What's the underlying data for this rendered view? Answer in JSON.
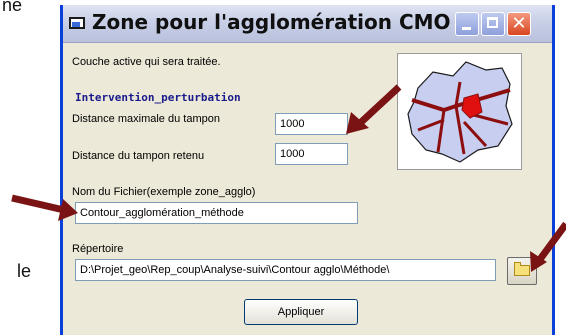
{
  "background": {
    "left_fragment_top": "ne",
    "left_fragment_bottom": "le"
  },
  "window": {
    "title": "Zone pour l'agglomération CMO",
    "title_bar_buttons": [
      "minimize",
      "maximize",
      "close"
    ],
    "close_glyph": "✕",
    "accent_color": "#0a3fd8"
  },
  "form": {
    "active_layer_caption": "Couche active qui sera traitée.",
    "active_layer_name": "Intervention_perturbation",
    "max_buffer_label": "Distance maximale du tampon",
    "max_buffer_value": "1000",
    "retained_buffer_label": "Distance du tampon retenu",
    "retained_buffer_value": "1000",
    "file_name_label": "Nom du Fichier(exemple zone_agglo)",
    "file_name_value": "Contour_agglomération_méthode",
    "directory_label": "Répertoire",
    "directory_value": "D:\\Projet_geo\\Rep_coup\\Analyse-suivi\\Contour agglo\\Méthode\\",
    "apply_button": "Appliquer"
  },
  "icons": {
    "window_icon": "window-icon",
    "browse_icon": "folder-icon",
    "map_preview": "map-thumbnail-icon"
  },
  "annotation": {
    "arrow_color": "#7a1414"
  }
}
